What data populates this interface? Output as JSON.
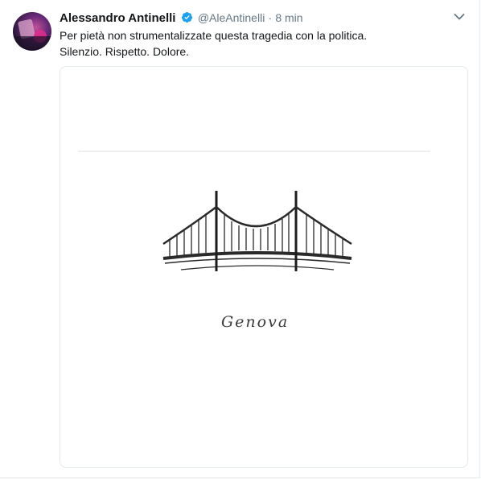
{
  "tweet": {
    "author_name": "Alessandro Antinelli",
    "handle": "@AleAntinelli",
    "separator": "·",
    "time": "8 min",
    "text_lines": [
      "Per pietà non strumentalizzate questa tragedia con la politica.",
      "Silenzio. Rispetto. Dolore."
    ],
    "media_caption": "Genova"
  },
  "icons": {
    "verified": "verified-badge-icon",
    "menu": "chevron-down-icon"
  },
  "colors": {
    "verified": "#1da1f2",
    "secondary_text": "#657786",
    "border": "#e1e8ed"
  }
}
